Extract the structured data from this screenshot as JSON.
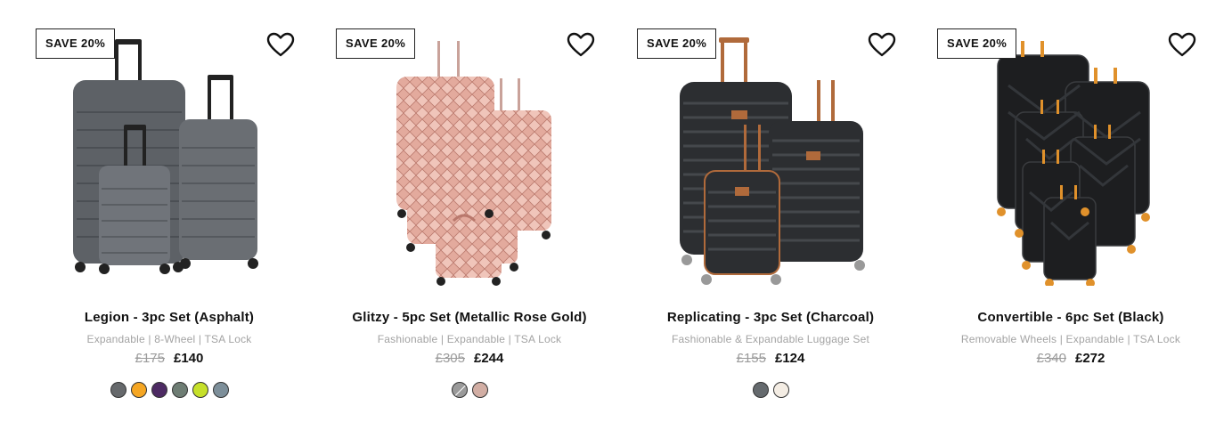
{
  "products": [
    {
      "badge": "SAVE 20%",
      "name": "Legion - 3pc Set (Asphalt)",
      "desc": "Expandable | 8-Wheel | TSA Lock",
      "was": "£175",
      "now": "£140",
      "image_icon": "luggage-set-image",
      "swatches": [
        {
          "color": "#66696c",
          "available": true
        },
        {
          "color": "#f5a623",
          "available": true
        },
        {
          "color": "#4d2a63",
          "available": true
        },
        {
          "color": "#6e7d74",
          "available": true
        },
        {
          "color": "#c6e02a",
          "available": true
        },
        {
          "color": "#7d8f9a",
          "available": true
        }
      ]
    },
    {
      "badge": "SAVE 20%",
      "name": "Glitzy - 5pc Set (Metallic Rose Gold)",
      "desc": "Fashionable | Expandable | TSA Lock",
      "was": "£305",
      "now": "£244",
      "image_icon": "luggage-set-image",
      "swatches": [
        {
          "color": "#9a9a9a",
          "available": false
        },
        {
          "color": "#d2aea4",
          "available": true
        }
      ]
    },
    {
      "badge": "SAVE 20%",
      "name": "Replicating - 3pc Set (Charcoal)",
      "desc": "Fashionable & Expandable Luggage Set",
      "was": "£155",
      "now": "£124",
      "image_icon": "luggage-set-image",
      "swatches": [
        {
          "color": "#656a6e",
          "available": true
        },
        {
          "color": "#f4ede4",
          "available": true
        }
      ]
    },
    {
      "badge": "SAVE 20%",
      "name": "Convertible - 6pc Set (Black)",
      "desc": "Removable Wheels | Expandable | TSA Lock",
      "was": "£340",
      "now": "£272",
      "image_icon": "luggage-set-image",
      "swatches": []
    }
  ]
}
